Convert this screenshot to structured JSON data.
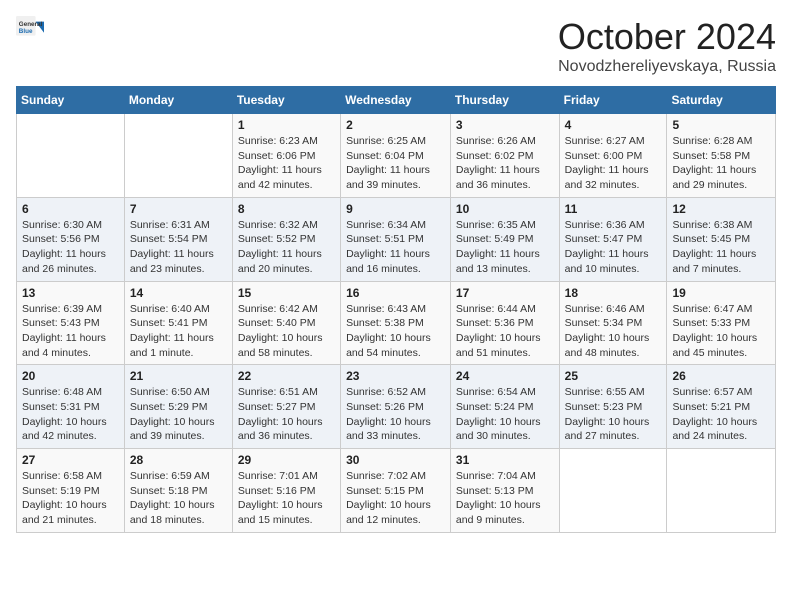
{
  "logo": {
    "general": "General",
    "blue": "Blue"
  },
  "header": {
    "month": "October 2024",
    "location": "Novodzhereliyevskaya, Russia"
  },
  "weekdays": [
    "Sunday",
    "Monday",
    "Tuesday",
    "Wednesday",
    "Thursday",
    "Friday",
    "Saturday"
  ],
  "weeks": [
    [
      null,
      null,
      {
        "day": "1",
        "sunrise": "Sunrise: 6:23 AM",
        "sunset": "Sunset: 6:06 PM",
        "daylight": "Daylight: 11 hours and 42 minutes."
      },
      {
        "day": "2",
        "sunrise": "Sunrise: 6:25 AM",
        "sunset": "Sunset: 6:04 PM",
        "daylight": "Daylight: 11 hours and 39 minutes."
      },
      {
        "day": "3",
        "sunrise": "Sunrise: 6:26 AM",
        "sunset": "Sunset: 6:02 PM",
        "daylight": "Daylight: 11 hours and 36 minutes."
      },
      {
        "day": "4",
        "sunrise": "Sunrise: 6:27 AM",
        "sunset": "Sunset: 6:00 PM",
        "daylight": "Daylight: 11 hours and 32 minutes."
      },
      {
        "day": "5",
        "sunrise": "Sunrise: 6:28 AM",
        "sunset": "Sunset: 5:58 PM",
        "daylight": "Daylight: 11 hours and 29 minutes."
      }
    ],
    [
      {
        "day": "6",
        "sunrise": "Sunrise: 6:30 AM",
        "sunset": "Sunset: 5:56 PM",
        "daylight": "Daylight: 11 hours and 26 minutes."
      },
      {
        "day": "7",
        "sunrise": "Sunrise: 6:31 AM",
        "sunset": "Sunset: 5:54 PM",
        "daylight": "Daylight: 11 hours and 23 minutes."
      },
      {
        "day": "8",
        "sunrise": "Sunrise: 6:32 AM",
        "sunset": "Sunset: 5:52 PM",
        "daylight": "Daylight: 11 hours and 20 minutes."
      },
      {
        "day": "9",
        "sunrise": "Sunrise: 6:34 AM",
        "sunset": "Sunset: 5:51 PM",
        "daylight": "Daylight: 11 hours and 16 minutes."
      },
      {
        "day": "10",
        "sunrise": "Sunrise: 6:35 AM",
        "sunset": "Sunset: 5:49 PM",
        "daylight": "Daylight: 11 hours and 13 minutes."
      },
      {
        "day": "11",
        "sunrise": "Sunrise: 6:36 AM",
        "sunset": "Sunset: 5:47 PM",
        "daylight": "Daylight: 11 hours and 10 minutes."
      },
      {
        "day": "12",
        "sunrise": "Sunrise: 6:38 AM",
        "sunset": "Sunset: 5:45 PM",
        "daylight": "Daylight: 11 hours and 7 minutes."
      }
    ],
    [
      {
        "day": "13",
        "sunrise": "Sunrise: 6:39 AM",
        "sunset": "Sunset: 5:43 PM",
        "daylight": "Daylight: 11 hours and 4 minutes."
      },
      {
        "day": "14",
        "sunrise": "Sunrise: 6:40 AM",
        "sunset": "Sunset: 5:41 PM",
        "daylight": "Daylight: 11 hours and 1 minute."
      },
      {
        "day": "15",
        "sunrise": "Sunrise: 6:42 AM",
        "sunset": "Sunset: 5:40 PM",
        "daylight": "Daylight: 10 hours and 58 minutes."
      },
      {
        "day": "16",
        "sunrise": "Sunrise: 6:43 AM",
        "sunset": "Sunset: 5:38 PM",
        "daylight": "Daylight: 10 hours and 54 minutes."
      },
      {
        "day": "17",
        "sunrise": "Sunrise: 6:44 AM",
        "sunset": "Sunset: 5:36 PM",
        "daylight": "Daylight: 10 hours and 51 minutes."
      },
      {
        "day": "18",
        "sunrise": "Sunrise: 6:46 AM",
        "sunset": "Sunset: 5:34 PM",
        "daylight": "Daylight: 10 hours and 48 minutes."
      },
      {
        "day": "19",
        "sunrise": "Sunrise: 6:47 AM",
        "sunset": "Sunset: 5:33 PM",
        "daylight": "Daylight: 10 hours and 45 minutes."
      }
    ],
    [
      {
        "day": "20",
        "sunrise": "Sunrise: 6:48 AM",
        "sunset": "Sunset: 5:31 PM",
        "daylight": "Daylight: 10 hours and 42 minutes."
      },
      {
        "day": "21",
        "sunrise": "Sunrise: 6:50 AM",
        "sunset": "Sunset: 5:29 PM",
        "daylight": "Daylight: 10 hours and 39 minutes."
      },
      {
        "day": "22",
        "sunrise": "Sunrise: 6:51 AM",
        "sunset": "Sunset: 5:27 PM",
        "daylight": "Daylight: 10 hours and 36 minutes."
      },
      {
        "day": "23",
        "sunrise": "Sunrise: 6:52 AM",
        "sunset": "Sunset: 5:26 PM",
        "daylight": "Daylight: 10 hours and 33 minutes."
      },
      {
        "day": "24",
        "sunrise": "Sunrise: 6:54 AM",
        "sunset": "Sunset: 5:24 PM",
        "daylight": "Daylight: 10 hours and 30 minutes."
      },
      {
        "day": "25",
        "sunrise": "Sunrise: 6:55 AM",
        "sunset": "Sunset: 5:23 PM",
        "daylight": "Daylight: 10 hours and 27 minutes."
      },
      {
        "day": "26",
        "sunrise": "Sunrise: 6:57 AM",
        "sunset": "Sunset: 5:21 PM",
        "daylight": "Daylight: 10 hours and 24 minutes."
      }
    ],
    [
      {
        "day": "27",
        "sunrise": "Sunrise: 6:58 AM",
        "sunset": "Sunset: 5:19 PM",
        "daylight": "Daylight: 10 hours and 21 minutes."
      },
      {
        "day": "28",
        "sunrise": "Sunrise: 6:59 AM",
        "sunset": "Sunset: 5:18 PM",
        "daylight": "Daylight: 10 hours and 18 minutes."
      },
      {
        "day": "29",
        "sunrise": "Sunrise: 7:01 AM",
        "sunset": "Sunset: 5:16 PM",
        "daylight": "Daylight: 10 hours and 15 minutes."
      },
      {
        "day": "30",
        "sunrise": "Sunrise: 7:02 AM",
        "sunset": "Sunset: 5:15 PM",
        "daylight": "Daylight: 10 hours and 12 minutes."
      },
      {
        "day": "31",
        "sunrise": "Sunrise: 7:04 AM",
        "sunset": "Sunset: 5:13 PM",
        "daylight": "Daylight: 10 hours and 9 minutes."
      },
      null,
      null
    ]
  ]
}
